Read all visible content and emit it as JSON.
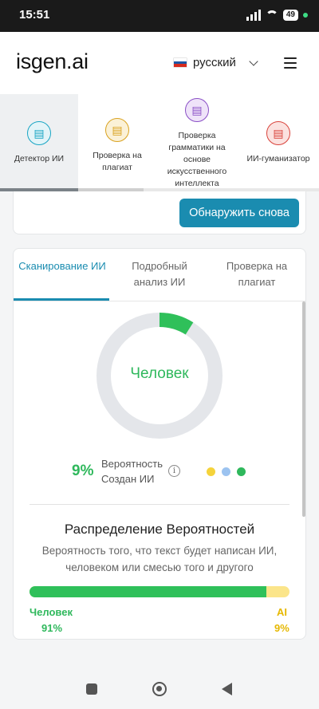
{
  "status_bar": {
    "time": "15:51",
    "battery": "49"
  },
  "header": {
    "logo": "isgen.ai",
    "language": "русский",
    "flag_colors": [
      "#ffffff",
      "#1c57a5",
      "#d52b1e"
    ]
  },
  "tools": [
    {
      "label": "Детектор ИИ",
      "icon": "document-scan-icon",
      "active": true,
      "color": "#18a5c4",
      "bg": "#e3f4f8"
    },
    {
      "label": "Проверка на плагиат",
      "icon": "document-search-icon",
      "active": false,
      "color": "#d9a21f",
      "bg": "#fbf1d7"
    },
    {
      "label": "Проверка грамматики на основе искусственного интеллекта",
      "icon": "document-check-icon",
      "active": false,
      "color": "#8a4fc6",
      "bg": "#efe3f9"
    },
    {
      "label": "ИИ-гуманизатор",
      "icon": "document-edit-icon",
      "active": false,
      "color": "#d9433b",
      "bg": "#fbe2e0"
    }
  ],
  "actions": {
    "detect_again": "Обнаружить снова"
  },
  "result_tabs": [
    {
      "label": "Сканирование ИИ",
      "active": true
    },
    {
      "label": "Подробный анализ ИИ",
      "active": false
    },
    {
      "label": "Проверка на плагиат",
      "active": false
    }
  ],
  "result": {
    "verdict": "Человек",
    "ai_probability": "9%",
    "ai_probability_value": 9,
    "ai_probability_label": "Вероятность Создан ИИ",
    "legend_dots": [
      "#f5d33b",
      "#9cc3f0",
      "#2fb85c"
    ],
    "ring_color": "#2fc05a",
    "ring_track_color": "#e4e6ea"
  },
  "distribution": {
    "title": "Распределение Вероятностей",
    "description": "Вероятность того, что текст будет написан ИИ, человеком или смесью того и другого",
    "human_label": "Человек",
    "human_pct": "91%",
    "human_value": 91,
    "ai_label": "AI",
    "ai_pct": "9%",
    "ai_value": 9
  }
}
